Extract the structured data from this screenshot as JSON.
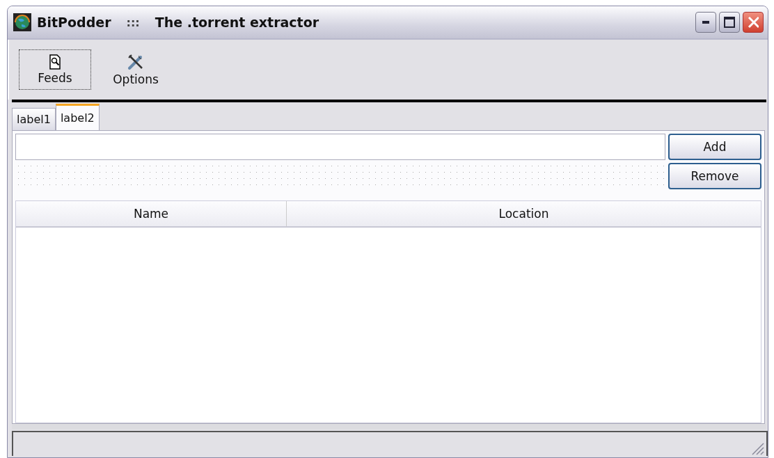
{
  "window": {
    "title": "BitPodder",
    "separator": ":::",
    "subtitle": "The .torrent extractor"
  },
  "toolbar": [
    {
      "label": "Feeds",
      "selected": true
    },
    {
      "label": "Options",
      "selected": false
    }
  ],
  "tabs": [
    {
      "label": "label1",
      "selected": false
    },
    {
      "label": "label2",
      "selected": true
    }
  ],
  "buttons": [
    "Add",
    "Remove"
  ],
  "table": {
    "columns": [
      "Name",
      "Location"
    ]
  }
}
